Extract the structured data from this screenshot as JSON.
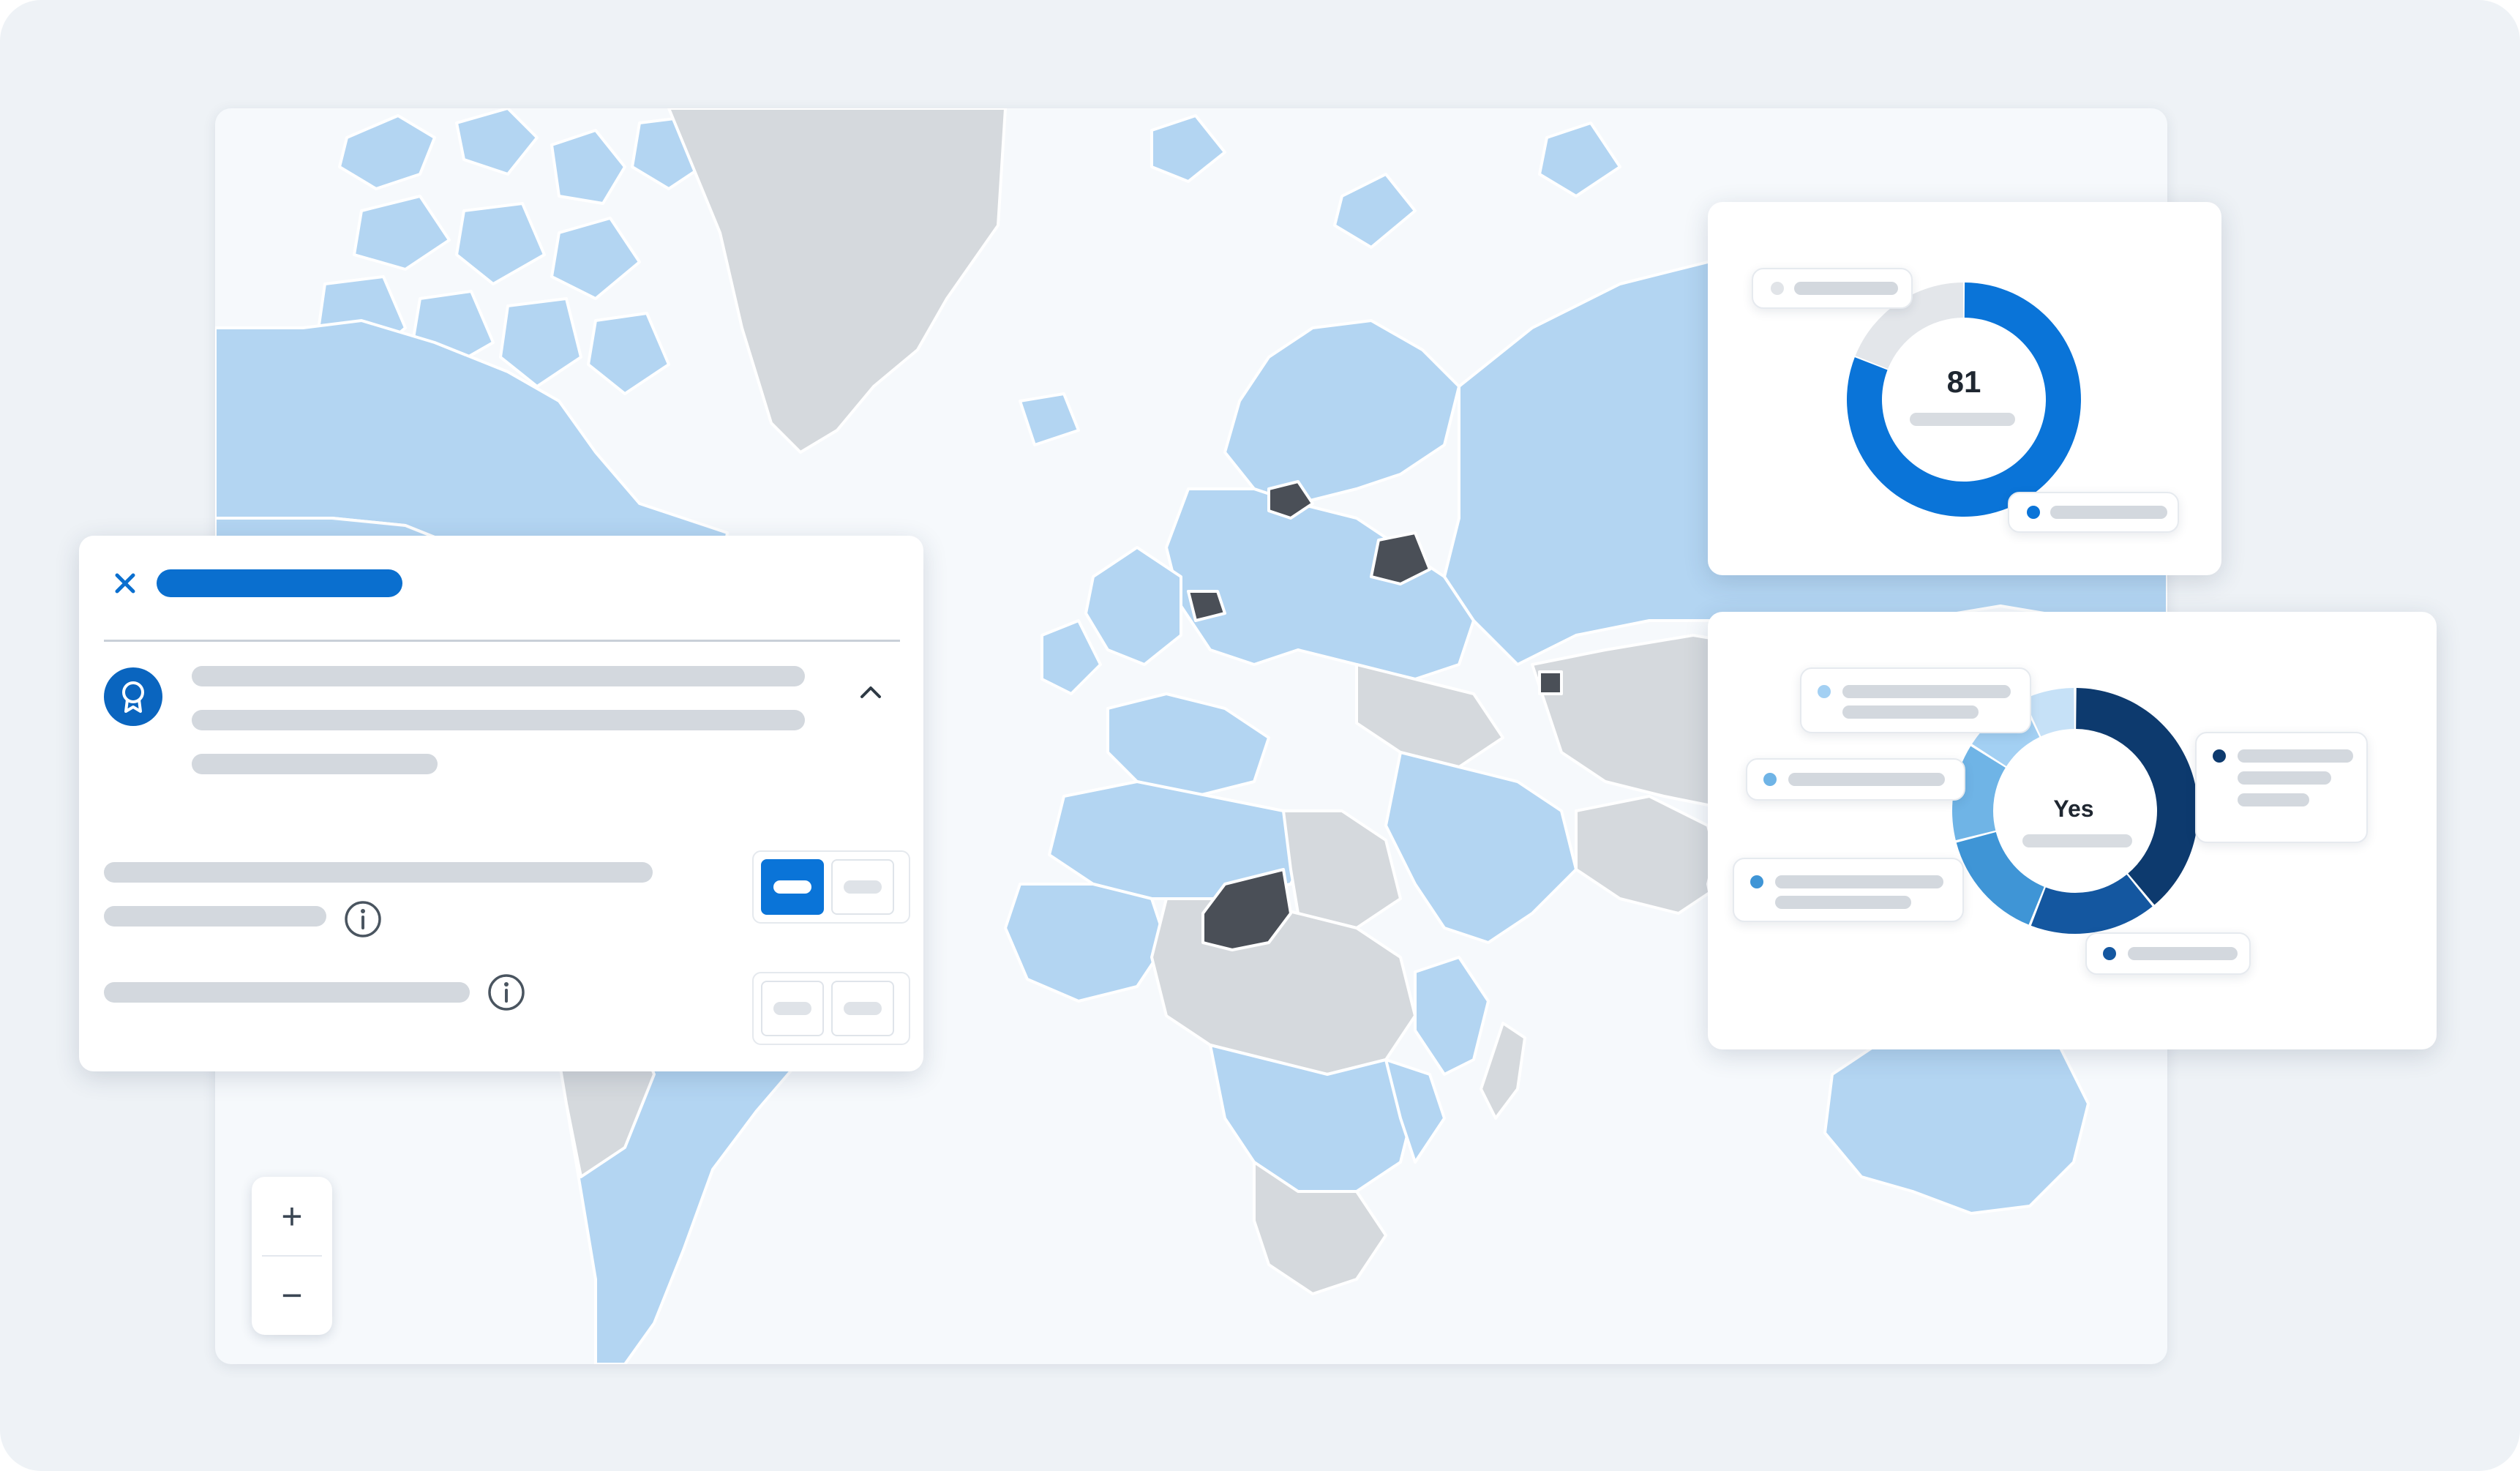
{
  "map": {
    "zoom_in_label": "+",
    "zoom_out_label": "−",
    "colors": {
      "ocean": "#f6f9fc",
      "land_blue": "#b3d5f2",
      "land_gray": "#d5d9dd",
      "highlight": "#4a4f57",
      "border": "#ffffff"
    }
  },
  "detail_panel": {
    "icons": {
      "close": "close-icon",
      "badge": "award-badge-icon",
      "collapse": "chevron-up-icon",
      "info": "info-icon"
    },
    "accent": "#0a6fcf"
  },
  "gauge_card": {
    "value_label": "81",
    "chart_data": {
      "type": "pie",
      "title": "",
      "slices": [
        {
          "name": "",
          "value": 81,
          "color": "#0a74d8"
        },
        {
          "name": "",
          "value": 19,
          "color": "#e3e6ea"
        }
      ]
    }
  },
  "pie_card": {
    "center_label": "Yes",
    "chart_data": {
      "type": "pie",
      "title": "",
      "slices": [
        {
          "name": "",
          "value": 39,
          "color": "#0d3a6e"
        },
        {
          "name": "",
          "value": 17,
          "color": "#1457a0"
        },
        {
          "name": "",
          "value": 15,
          "color": "#3f95d6"
        },
        {
          "name": "",
          "value": 13,
          "color": "#6fb4e6"
        },
        {
          "name": "",
          "value": 9,
          "color": "#a3d0f3"
        },
        {
          "name": "",
          "value": 7,
          "color": "#c6e1f7"
        }
      ]
    }
  }
}
